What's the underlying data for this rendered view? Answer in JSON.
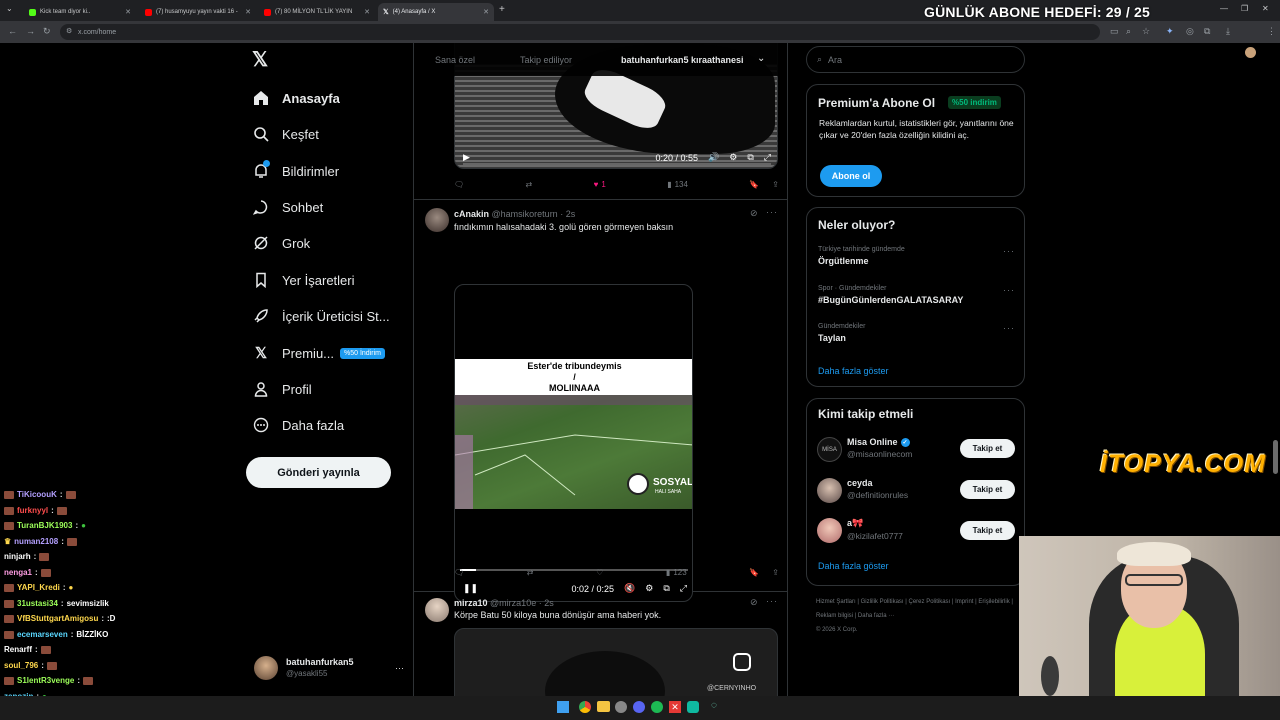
{
  "browser": {
    "tabs": [
      {
        "title": "Kick team diyor ki..",
        "color": "#53fc18"
      },
      {
        "title": "(7) husamyuyu yayın vakti 16 -",
        "color": "#ff0000"
      },
      {
        "title": "(7) 80 MİLYON TL'LİK YAYIN",
        "color": "#ff0000"
      },
      {
        "title": "(4) Anasayfa / X",
        "color": "#ffffff"
      }
    ],
    "url": "x.com/home",
    "overlay_goal": "GÜNLÜK ABONE HEDEFİ: 29 / 25"
  },
  "nav": {
    "items": [
      {
        "label": "Anasayfa",
        "icon": "home-icon"
      },
      {
        "label": "Keşfet",
        "icon": "search-icon"
      },
      {
        "label": "Bildirimler",
        "icon": "bell-icon"
      },
      {
        "label": "Sohbet",
        "icon": "chat-icon"
      },
      {
        "label": "Grok",
        "icon": "grok-icon"
      },
      {
        "label": "Yer İşaretleri",
        "icon": "bookmark-icon"
      },
      {
        "label": "İçerik Üreticisi St...",
        "icon": "rocket-icon"
      },
      {
        "label": "Premiu...",
        "icon": "x-logo-icon",
        "badge": "%50 İndirim"
      },
      {
        "label": "Profil",
        "icon": "person-icon"
      },
      {
        "label": "Daha fazla",
        "icon": "more-icon"
      }
    ],
    "post_button": "Gönderi yayınla",
    "account": {
      "name": "batuhanfurkan5",
      "handle": "@yasakli55"
    }
  },
  "feed": {
    "tabs": [
      "Sana özel",
      "Takip ediliyor",
      "batuhanfurkan5 kıraathanesi"
    ],
    "tweet0": {
      "time": "0:20 / 0:55",
      "likes": "1",
      "views": "134"
    },
    "tweet1": {
      "name": "cAnakin",
      "handle": "@hamsikoreturn",
      "age": "· 2s",
      "text": "fındıkımın halısahadaki 3. golü gören görmeyen baksın",
      "video_caption_1": "Ester'de tribundeymis",
      "video_caption_2": "/",
      "video_caption_3": "MOLIINAAA",
      "watermark": "SOSYAL",
      "watermark_sub": "HALI SAHA",
      "time": "0:02 / 0:25",
      "views": "123"
    },
    "tweet2": {
      "name": "mirza10",
      "handle": "@mirza10e",
      "age": "· 2s",
      "text": "Körpe Batu 50 kiloya buna dönüşür ama haberi yok.",
      "watermark": "@CERNYINHO"
    }
  },
  "right": {
    "search_placeholder": "Ara",
    "premium": {
      "title": "Premium'a Abone Ol",
      "badge": "%50 indirim",
      "body": "Reklamlardan kurtul, istatistikleri gör, yanıtlarını öne çıkar ve 20'den fazla özelliğin kilidini aç.",
      "button": "Abone ol"
    },
    "trends": {
      "title": "Neler oluyor?",
      "items": [
        {
          "context": "Türkiye tarihinde gündemde",
          "topic": "Örgütlenme"
        },
        {
          "context": "Spor · Gündemdekiler",
          "topic": "#BugünGünlerdenGALATASARAY"
        },
        {
          "context": "Gündemdekiler",
          "topic": "Taylan"
        }
      ],
      "more": "Daha fazla göster"
    },
    "who_to_follow": {
      "title": "Kimi takip etmeli",
      "items": [
        {
          "name": "Misa Online",
          "handle": "@misaonlinecom",
          "button": "Takip et",
          "avatar_text": "MİSA"
        },
        {
          "name": "ceyda",
          "handle": "@definitionrules",
          "button": "Takip et"
        },
        {
          "name": "a🎀",
          "handle": "@kizilafet0777",
          "button": "Takip et"
        }
      ],
      "more": "Daha fazla göster"
    },
    "footer": {
      "links": [
        "Hizmet Şartları",
        "Gizlilik Politikası",
        "Çerez Politikası",
        "Imprint",
        "Erişilebilirlik",
        "Reklam bilgisi",
        "Daha fazla ···"
      ],
      "copyright": "© 2026 X Corp."
    }
  },
  "chat": [
    {
      "user": "TiKicoouK",
      "msg": "",
      "color": "#b4a0ff"
    },
    {
      "user": "furknyyl",
      "msg": "",
      "color": "#ff4d4d"
    },
    {
      "user": "TuranBJK1903",
      "msg": "",
      "color": "#9dff5a"
    },
    {
      "user": "numan2108",
      "msg": "",
      "color": "#b4a0ff"
    },
    {
      "user": "ninjarh",
      "msg": "",
      "color": "#ffffff"
    },
    {
      "user": "nenga1",
      "msg": "",
      "color": "#ff9de3"
    },
    {
      "user": "YAPI_Kredi",
      "msg": "",
      "color": "#ffd84d"
    },
    {
      "user": "31ustasi34",
      "msg": "sevimsizlik",
      "color": "#9dff5a"
    },
    {
      "user": "VfBStuttgartAmigosu",
      "msg": ":D",
      "color": "#ffd84d"
    },
    {
      "user": "ecemarseven",
      "msg": "BİZZİKO",
      "color": "#5ad7ff"
    },
    {
      "user": "Renarff",
      "msg": "",
      "color": "#ffffff"
    },
    {
      "user": "soul_796",
      "msg": "",
      "color": "#ffd84d"
    },
    {
      "user": "S1lentR3venge",
      "msg": "",
      "color": "#9dff5a"
    },
    {
      "user": "zepozin",
      "msg": "",
      "color": "#5ad7ff"
    },
    {
      "user": "lnn",
      "msg": "",
      "color": "#ff4d4d"
    }
  ],
  "overlay_brand": "İTOPYA.COM"
}
